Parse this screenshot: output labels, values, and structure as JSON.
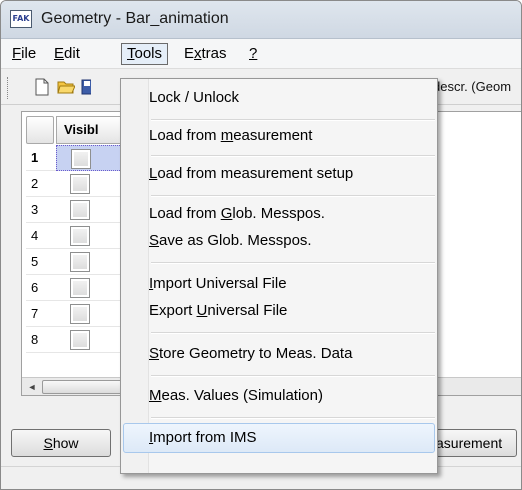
{
  "window": {
    "title": "Geometry - Bar_animation",
    "app_icon_text": "FAK"
  },
  "menubar": {
    "file": {
      "accel": "F",
      "rest": "ile"
    },
    "edit": {
      "accel": "E",
      "rest": "dit"
    },
    "tools": {
      "accel": "T",
      "rest": "ools"
    },
    "extras": {
      "pre": "E",
      "accel": "x",
      "rest": "tras"
    },
    "help": {
      "accel": "?"
    }
  },
  "toolbar": {
    "descr_label": "descr. (Geom"
  },
  "grid": {
    "column_header": "Visibl",
    "rows": [
      "1",
      "2",
      "3",
      "4",
      "5",
      "6",
      "7",
      "8"
    ]
  },
  "buttons": {
    "show": {
      "accel": "S",
      "rest": "how"
    },
    "measurement": "asurement"
  },
  "tools_menu": {
    "lock": "Lock / Unlock",
    "load_meas": {
      "pre": "Load from ",
      "accel": "m",
      "rest": "easurement"
    },
    "load_setup": {
      "accel": "L",
      "rest": "oad from measurement setup"
    },
    "load_glob": {
      "pre": "Load from ",
      "accel": "G",
      "rest": "lob. Messpos."
    },
    "save_glob": {
      "accel": "S",
      "rest": "ave as Glob. Messpos."
    },
    "import_uff": {
      "accel": "I",
      "rest": "mport Universal File"
    },
    "export_uff": {
      "pre": "Export ",
      "accel": "U",
      "rest": "niversal File"
    },
    "store_geom": {
      "accel": "S",
      "rest": "tore Geometry to Meas. Data"
    },
    "meas_values": {
      "accel": "M",
      "rest": "eas. Values (Simulation)"
    },
    "import_ims": {
      "accel": "I",
      "rest": "mport from IMS"
    }
  }
}
